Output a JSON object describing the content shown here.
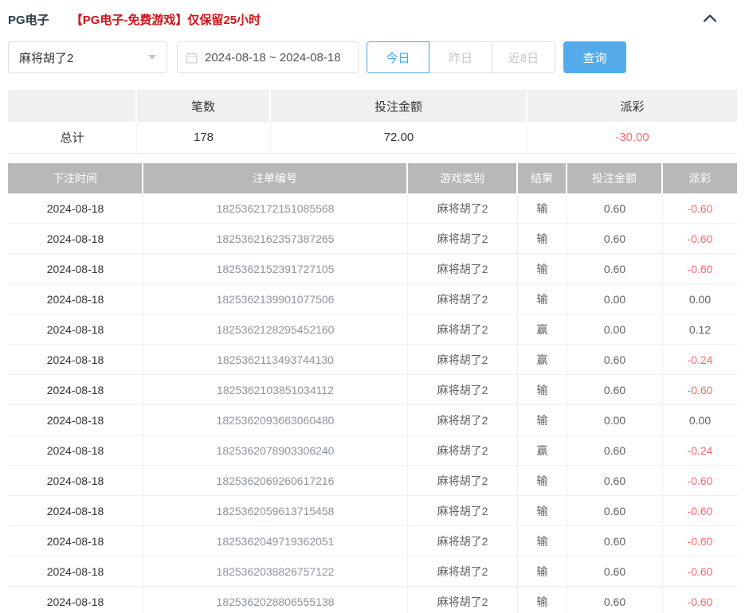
{
  "colors": {
    "accent_blue": "#54abea",
    "active_tab_blue": "#4da3e8",
    "danger_red": "#f56c6c",
    "notice_red": "#d01318",
    "title_navy": "#2b3a4d",
    "table_header_bg": "#b8b8b8",
    "summary_header_bg": "#f0f0f0"
  },
  "icons": {
    "collapse": "chevron-up",
    "calendar": "calendar",
    "select_caret": "caret-down"
  },
  "header": {
    "title": "PG电子",
    "notice": "【PG电子-免费游戏】仅保留25小时"
  },
  "filters": {
    "game_select": {
      "value": "麻将胡了2"
    },
    "date_range": {
      "value": "2024-08-18 ~ 2024-08-18"
    },
    "quick_buttons": [
      {
        "label": "今日",
        "active": true
      },
      {
        "label": "昨日",
        "active": false
      },
      {
        "label": "近8日",
        "active": false
      }
    ],
    "query_label": "查询"
  },
  "summary": {
    "headers": [
      "",
      "笔数",
      "投注金额",
      "派彩"
    ],
    "row": {
      "label": "总计",
      "count": "178",
      "bet_amount": "72.00",
      "payout": "-30.00"
    }
  },
  "table": {
    "headers": [
      "下注时间",
      "注单编号",
      "游戏类别",
      "结果",
      "投注金额",
      "派彩"
    ],
    "rows": [
      {
        "date": "2024-08-18",
        "bet_id": "1825362172151085568",
        "game": "麻将胡了2",
        "result": "输",
        "amount": "0.60",
        "payout": "-0.60"
      },
      {
        "date": "2024-08-18",
        "bet_id": "1825362162357387265",
        "game": "麻将胡了2",
        "result": "输",
        "amount": "0.60",
        "payout": "-0.60"
      },
      {
        "date": "2024-08-18",
        "bet_id": "1825362152391727105",
        "game": "麻将胡了2",
        "result": "输",
        "amount": "0.60",
        "payout": "-0.60"
      },
      {
        "date": "2024-08-18",
        "bet_id": "1825362139901077506",
        "game": "麻将胡了2",
        "result": "输",
        "amount": "0.00",
        "payout": "0.00"
      },
      {
        "date": "2024-08-18",
        "bet_id": "1825362128295452160",
        "game": "麻将胡了2",
        "result": "赢",
        "amount": "0.00",
        "payout": "0.12"
      },
      {
        "date": "2024-08-18",
        "bet_id": "1825362113493744130",
        "game": "麻将胡了2",
        "result": "赢",
        "amount": "0.60",
        "payout": "-0.24"
      },
      {
        "date": "2024-08-18",
        "bet_id": "1825362103851034112",
        "game": "麻将胡了2",
        "result": "输",
        "amount": "0.60",
        "payout": "-0.60"
      },
      {
        "date": "2024-08-18",
        "bet_id": "1825362093663060480",
        "game": "麻将胡了2",
        "result": "输",
        "amount": "0.00",
        "payout": "0.00"
      },
      {
        "date": "2024-08-18",
        "bet_id": "1825362078903306240",
        "game": "麻将胡了2",
        "result": "赢",
        "amount": "0.60",
        "payout": "-0.24"
      },
      {
        "date": "2024-08-18",
        "bet_id": "1825362069260617216",
        "game": "麻将胡了2",
        "result": "输",
        "amount": "0.60",
        "payout": "-0.60"
      },
      {
        "date": "2024-08-18",
        "bet_id": "1825362059613715458",
        "game": "麻将胡了2",
        "result": "输",
        "amount": "0.60",
        "payout": "-0.60"
      },
      {
        "date": "2024-08-18",
        "bet_id": "1825362049719362051",
        "game": "麻将胡了2",
        "result": "输",
        "amount": "0.60",
        "payout": "-0.60"
      },
      {
        "date": "2024-08-18",
        "bet_id": "1825362038826757122",
        "game": "麻将胡了2",
        "result": "输",
        "amount": "0.60",
        "payout": "-0.60"
      },
      {
        "date": "2024-08-18",
        "bet_id": "1825362028806555138",
        "game": "麻将胡了2",
        "result": "输",
        "amount": "0.60",
        "payout": "-0.60"
      }
    ]
  }
}
